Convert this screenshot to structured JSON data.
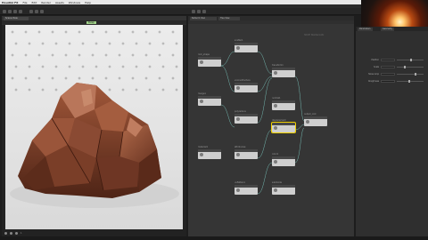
{
  "menubar": {
    "app_name": "Houdini FX",
    "items": [
      "File",
      "Edit",
      "Render",
      "Assets",
      "Windows",
      "Help"
    ]
  },
  "viewport": {
    "tab_label": "Scene View",
    "header_label": "Persp",
    "timeline_frame": "1"
  },
  "network": {
    "tab_labels": [
      "Network View",
      "Tree View"
    ],
    "watermark": "SOP Network",
    "nodes": [
      {
        "label": "rock_shape"
      },
      {
        "label": "scatter1"
      },
      {
        "label": "voronoifracture"
      },
      {
        "label": "transform1"
      },
      {
        "label": "merge1"
      },
      {
        "label": "polyreduce"
      },
      {
        "label": "attribnoise"
      },
      {
        "label": "output_rock"
      },
      {
        "label": "normal1"
      },
      {
        "label": "displacement"
      },
      {
        "label": "uvflatten1"
      },
      {
        "label": "color1"
      },
      {
        "label": "subdivide"
      },
      {
        "label": "material1"
      }
    ]
  },
  "parameters": {
    "tabs": [
      "Parameters",
      "Geometry"
    ],
    "rows": [
      {
        "label": "Position",
        "level": 0.55
      },
      {
        "label": "Scale",
        "level": 0.3
      },
      {
        "label": "Noise Amp",
        "level": 0.7
      },
      {
        "label": "Roughness",
        "level": 0.45
      }
    ]
  }
}
